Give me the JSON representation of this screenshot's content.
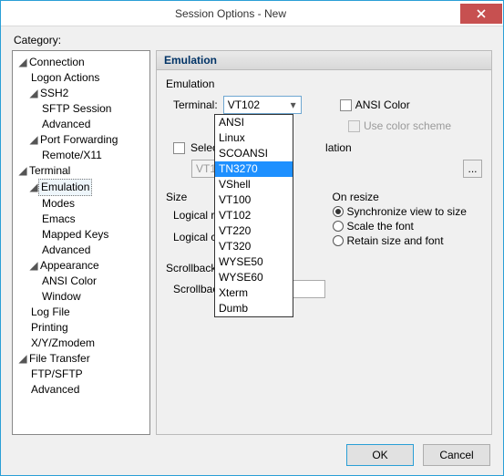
{
  "window": {
    "title": "Session Options - New"
  },
  "category_label": "Category:",
  "tree": {
    "connection": "Connection",
    "logon_actions": "Logon Actions",
    "ssh2": "SSH2",
    "sftp_session": "SFTP Session",
    "advanced1": "Advanced",
    "port_forwarding": "Port Forwarding",
    "remote_x11": "Remote/X11",
    "terminal": "Terminal",
    "emulation": "Emulation",
    "modes": "Modes",
    "emacs": "Emacs",
    "mapped_keys": "Mapped Keys",
    "advanced2": "Advanced",
    "appearance": "Appearance",
    "ansi_color": "ANSI Color",
    "window": "Window",
    "log_file": "Log File",
    "printing": "Printing",
    "xyz": "X/Y/Zmodem",
    "file_transfer": "File Transfer",
    "ftp_sftp": "FTP/SFTP",
    "advanced3": "Advanced"
  },
  "panel": {
    "header": "Emulation",
    "group_emulation": "Emulation",
    "terminal_label": "Terminal:",
    "terminal_value": "VT102",
    "ansi_color": "ANSI Color",
    "use_color_scheme": "Use color scheme",
    "select_alt": "Select an alternate keyboard emulation",
    "select_alt_visible": "Select an",
    "select_alt_tail": "lation",
    "vt100_field": "VT100",
    "dots": "...",
    "group_size": "Size",
    "logical_rows": "Logical rows",
    "logical_cols": "Logical colum",
    "on_resize": "On resize",
    "sync": "Synchronize view to size",
    "scale": "Scale the font",
    "retain": "Retain size and font",
    "group_scrollback": "Scrollback",
    "scrollback_buffer": "Scrollback buffer:",
    "scrollback_value": "500"
  },
  "dropdown": {
    "items": [
      "ANSI",
      "Linux",
      "SCOANSI",
      "TN3270",
      "VShell",
      "VT100",
      "VT102",
      "VT220",
      "VT320",
      "WYSE50",
      "WYSE60",
      "Xterm",
      "Dumb"
    ],
    "highlight_index": 3
  },
  "footer": {
    "ok": "OK",
    "cancel": "Cancel"
  }
}
